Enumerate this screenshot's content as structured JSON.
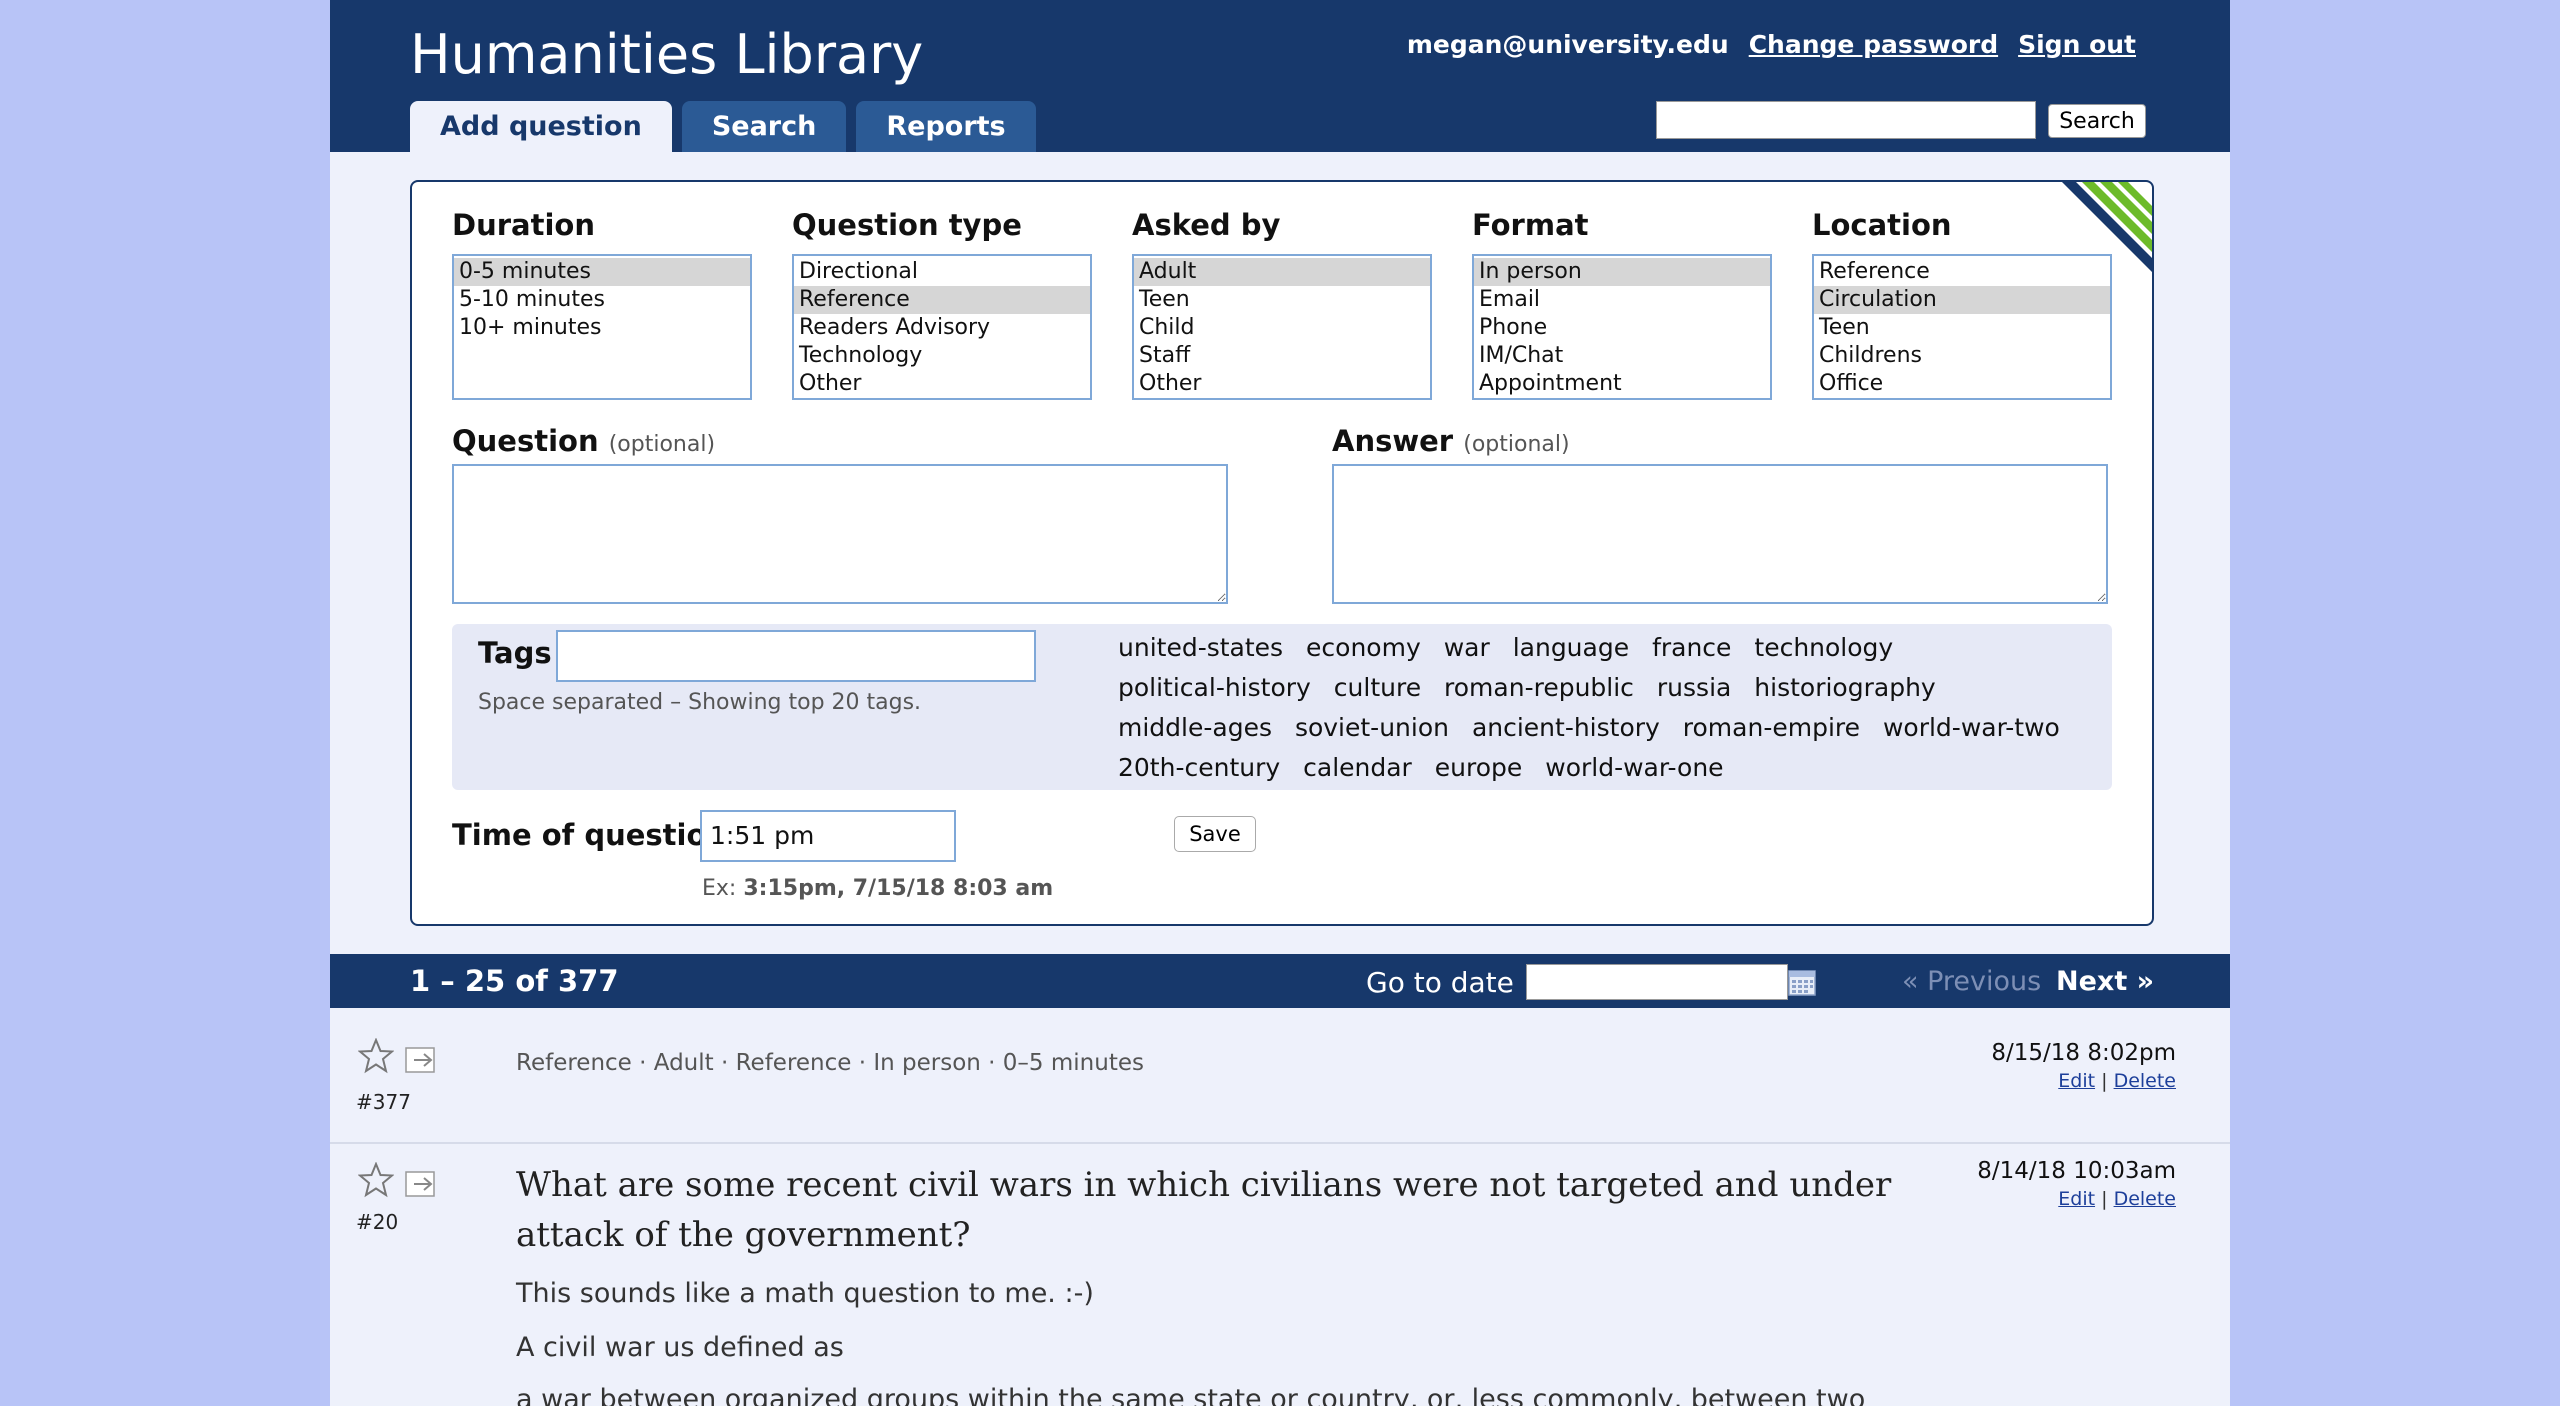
{
  "header": {
    "site_title": "Humanities Library",
    "user_email": "megan@university.edu",
    "change_password": "Change password",
    "sign_out": "Sign out",
    "tabs": [
      {
        "label": "Add question",
        "active": true
      },
      {
        "label": "Search",
        "active": false
      },
      {
        "label": "Reports",
        "active": false
      }
    ],
    "search_value": "",
    "search_button": "Search"
  },
  "form": {
    "duration": {
      "label": "Duration",
      "options": [
        "0-5 minutes",
        "5-10 minutes",
        "10+ minutes"
      ],
      "selected": "0-5 minutes"
    },
    "question_type": {
      "label": "Question type",
      "options": [
        "Directional",
        "Reference",
        "Readers Advisory",
        "Technology",
        "Other"
      ],
      "selected": "Reference"
    },
    "asked_by": {
      "label": "Asked by",
      "options": [
        "Adult",
        "Teen",
        "Child",
        "Staff",
        "Other"
      ],
      "selected": "Adult"
    },
    "format": {
      "label": "Format",
      "options": [
        "In person",
        "Email",
        "Phone",
        "IM/Chat",
        "Appointment"
      ],
      "selected": "In person"
    },
    "location": {
      "label": "Location",
      "options": [
        "Reference",
        "Circulation",
        "Teen",
        "Childrens",
        "Office"
      ],
      "selected": "Circulation"
    },
    "question_label": "Question",
    "answer_label": "Answer",
    "optional_note": "(optional)",
    "tags_label": "Tags",
    "tags_hint": "Space separated – Showing top 20 tags.",
    "tags": [
      "united-states",
      "economy",
      "war",
      "language",
      "france",
      "technology",
      "political-history",
      "culture",
      "roman-republic",
      "russia",
      "historiography",
      "middle-ages",
      "soviet-union",
      "ancient-history",
      "roman-empire",
      "world-war-two",
      "20th-century",
      "calendar",
      "europe",
      "world-war-one"
    ],
    "time_label": "Time of question",
    "time_value": "1:51 pm",
    "save_label": "Save",
    "time_hint_prefix": "Ex:",
    "time_hint_examples": "3:15pm, 7/15/18 8:03 am"
  },
  "pager": {
    "count": "1 – 25 of 377",
    "goto_label": "Go to date",
    "prev": "« Previous",
    "next": "Next »"
  },
  "entries": [
    {
      "num": "#377",
      "meta": "Reference · Adult · Reference · In person · 0–5 minutes",
      "date": "8/15/18 8:02pm",
      "edit": "Edit",
      "sep": "|",
      "delete": "Delete"
    },
    {
      "num": "#20",
      "title": "What are some recent civil wars in which civilians were not targeted and under attack of the government?",
      "date": "8/14/18 10:03am",
      "edit": "Edit",
      "sep": "|",
      "delete": "Delete",
      "answer_lines": [
        "This sounds like a math question to me. :-)",
        "A civil war us defined as",
        "a war between organized groups within the same state or country, or, less commonly, between two"
      ]
    }
  ],
  "colors": {
    "navy": "#17386b",
    "tab_blue": "#2b5a95",
    "page_bg": "#b8c4f7",
    "stripe_green": "#6dbb2a"
  }
}
